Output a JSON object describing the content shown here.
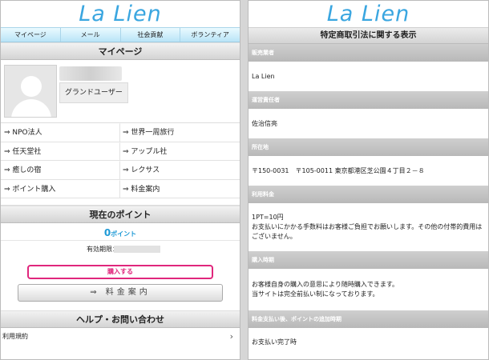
{
  "left": {
    "logo": "La Lien",
    "tabs": [
      "マイページ",
      "メール",
      "社会貢献",
      "ボランティア"
    ],
    "mypage_header": "マイページ",
    "rank": "グランドユーザー",
    "links": [
      "⇒ NPO法人",
      "⇒ 世界一周旅行",
      "⇒ 任天堂社",
      "⇒ アップル社",
      "⇒ 癒しの宿",
      "⇒ レクサス",
      "⇒ ポイント購入",
      "⇒ 料金案内"
    ],
    "points_header": "現在のポイント",
    "points_value": "0",
    "points_unit": "ポイント",
    "expiry_label": "有効期限：",
    "buy_button": "購入する",
    "price_button": "⇒ 料金案内",
    "help_header": "ヘルプ・お問い合わせ",
    "terms": "利用規約",
    "chevron": "›"
  },
  "right": {
    "logo": "La Lien",
    "title": "特定商取引法に関する表示",
    "sections": [
      {
        "label": "販売業者",
        "lines": [
          "La Lien"
        ]
      },
      {
        "label": "運営責任者",
        "lines": [
          "佐治信亮"
        ]
      },
      {
        "label": "所在地",
        "lines": [
          "〒150-0031　〒105-0011 東京都港区芝公園４丁目２－８"
        ]
      },
      {
        "label": "利用料金",
        "lines": [
          "1PT=10円",
          "お支払いにかかる手数料はお客様ご負担でお願いします。その他の付帯的費用は",
          "ございません。"
        ]
      },
      {
        "label": "購入時期",
        "lines": [
          "お客様自身の購入の意思により随時購入できます。",
          "当サイトは完全前払い制になっております。"
        ]
      },
      {
        "label": "料金支払い後、ポイントの追加時期",
        "lines": [
          "お支払い完了時"
        ]
      }
    ]
  },
  "colors": {
    "accent": "#1e9ad6",
    "buy": "#e0267c",
    "logo": "#3aa6e0"
  },
  "icons": {
    "avatar": "avatar-placeholder-icon",
    "chevron": "chevron-right-icon"
  }
}
